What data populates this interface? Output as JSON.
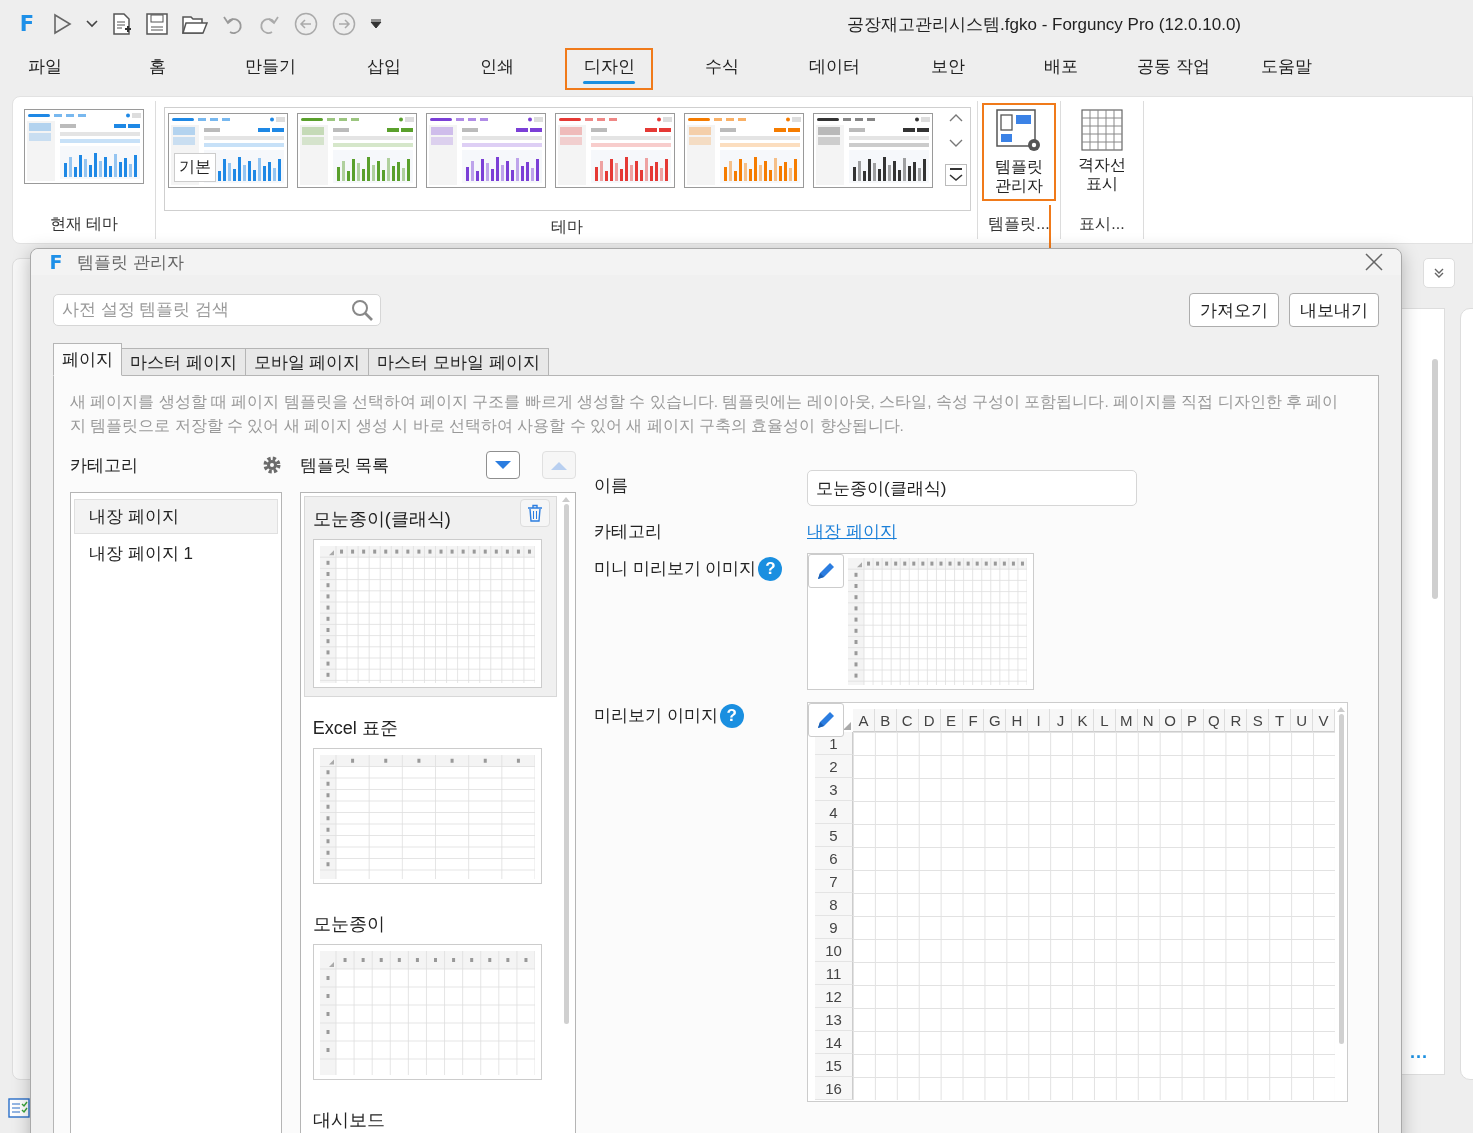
{
  "app": {
    "logo": "F",
    "title": "공장재고관리시스템.fgko - Forguncy Pro (12.0.10.0)"
  },
  "menu_tabs": [
    {
      "label": "파일",
      "selected": false,
      "highlighted": false
    },
    {
      "label": "홈",
      "selected": false,
      "highlighted": false
    },
    {
      "label": "만들기",
      "selected": false,
      "highlighted": false
    },
    {
      "label": "삽입",
      "selected": false,
      "highlighted": false
    },
    {
      "label": "인쇄",
      "selected": false,
      "highlighted": false
    },
    {
      "label": "디자인",
      "selected": true,
      "highlighted": true
    },
    {
      "label": "수식",
      "selected": false,
      "highlighted": false
    },
    {
      "label": "데이터",
      "selected": false,
      "highlighted": false
    },
    {
      "label": "보안",
      "selected": false,
      "highlighted": false
    },
    {
      "label": "배포",
      "selected": false,
      "highlighted": false
    },
    {
      "label": "공동 작업",
      "selected": false,
      "highlighted": false
    },
    {
      "label": "도움말",
      "selected": false,
      "highlighted": false
    }
  ],
  "ribbon": {
    "current_theme": {
      "color": "#1e88e5",
      "label": "현재 테마"
    },
    "themes": [
      {
        "color": "#1e88e5",
        "tooltip": "기본"
      },
      {
        "color": "#5aa02c"
      },
      {
        "color": "#7b3fd6"
      },
      {
        "color": "#e53935"
      },
      {
        "color": "#f57c00"
      },
      {
        "color": "#333333"
      }
    ],
    "theme_label": "테마",
    "buttons": [
      {
        "kind": "template",
        "label": "템플릿 관리자",
        "group_label": "템플릿...",
        "highlighted": true
      },
      {
        "kind": "gridlines",
        "label": "격자선 표시",
        "group_label": "표시...",
        "highlighted": false
      }
    ]
  },
  "background": {
    "more": "···"
  },
  "dialog": {
    "logo": "F",
    "title": "템플릿 관리자",
    "search": {
      "placeholder": "사전 설정 템플릿 검색"
    },
    "buttons": [
      "가져오기",
      "내보내기"
    ],
    "tabs": [
      {
        "label": "페이지",
        "selected": true
      },
      {
        "label": "마스터 페이지",
        "selected": false
      },
      {
        "label": "모바일 페이지",
        "selected": false
      },
      {
        "label": "마스터 모바일 페이지",
        "selected": false
      }
    ],
    "description": "새 페이지를 생성할 때 페이지 템플릿을 선택하여 페이지 구조를 빠르게 생성할 수 있습니다. 템플릿에는 레이아웃, 스타일, 속성 구성이 포함됩니다. 페이지를 직접 디자인한 후 페이지 템플릿으로 저장할 수 있어 새 페이지 생성 시 바로 선택하여 사용할 수 있어 새 페이지 구축의 효율성이 향상됩니다.",
    "category_header": "카테고리",
    "template_header": "템플릿 목록",
    "sort_buttons": [
      {
        "kind": "down",
        "disabled": false
      },
      {
        "kind": "up",
        "disabled": true
      }
    ],
    "categories": [
      {
        "label": "내장 페이지",
        "selected": true
      },
      {
        "label": "내장 페이지 1",
        "selected": false
      }
    ],
    "templates": [
      {
        "name": "모눈종이(클래식)",
        "selected": true,
        "kind": "fine_grid"
      },
      {
        "name": "Excel 표준",
        "selected": false,
        "kind": "wide_grid"
      },
      {
        "name": "모눈종이",
        "selected": false,
        "kind": "square_grid"
      },
      {
        "name": "대시보드",
        "selected": false
      }
    ],
    "properties": {
      "name_label": "이름",
      "name_value": "모눈종이(클래식)",
      "category_label": "카테고리",
      "category_link": "내장 페이지",
      "mini_label": "미니 미리보기 이미지",
      "mini_help": "?",
      "mini_preview": {
        "kind": "fine_grid"
      },
      "preview_label": "미리보기 이미지",
      "preview_help": "?",
      "preview_grid": {
        "columns": [
          "A",
          "B",
          "C",
          "D",
          "E",
          "F",
          "G",
          "H",
          "I",
          "J",
          "K",
          "L",
          "M",
          "N",
          "O",
          "P",
          "Q",
          "R",
          "S",
          "T",
          "U",
          "V"
        ],
        "rows": [
          "1",
          "2",
          "3",
          "4",
          "5",
          "6",
          "7",
          "8",
          "9",
          "10",
          "11",
          "12",
          "13",
          "14",
          "15",
          "16"
        ]
      }
    }
  }
}
